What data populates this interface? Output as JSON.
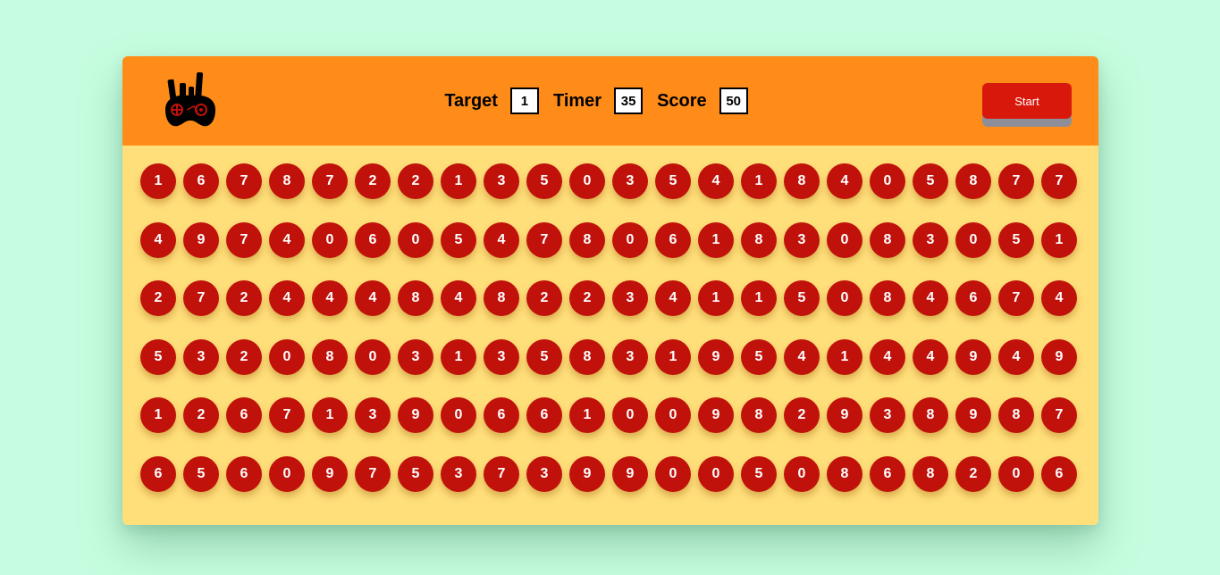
{
  "header": {
    "logo": "game-controller-hand-logo",
    "target_label": "Target",
    "target_value": "1",
    "timer_label": "Timer",
    "timer_value": "35",
    "score_label": "Score",
    "score_value": "50",
    "start_label": "Start"
  },
  "colors": {
    "background": "#c6fde0",
    "header": "#ff8c19",
    "board": "#ffdf7a",
    "ball": "#c0120b",
    "start_button": "#d9180c"
  },
  "board": {
    "rows": [
      [
        "1",
        "6",
        "7",
        "8",
        "7",
        "2",
        "2",
        "1",
        "3",
        "5",
        "0",
        "3",
        "5",
        "4",
        "1",
        "8",
        "4",
        "0",
        "5",
        "8",
        "7",
        "7"
      ],
      [
        "4",
        "9",
        "7",
        "4",
        "0",
        "6",
        "0",
        "5",
        "4",
        "7",
        "8",
        "0",
        "6",
        "1",
        "8",
        "3",
        "0",
        "8",
        "3",
        "0",
        "5",
        "1"
      ],
      [
        "2",
        "7",
        "2",
        "4",
        "4",
        "4",
        "8",
        "4",
        "8",
        "2",
        "2",
        "3",
        "4",
        "1",
        "1",
        "5",
        "0",
        "8",
        "4",
        "6",
        "7",
        "4"
      ],
      [
        "5",
        "3",
        "2",
        "0",
        "8",
        "0",
        "3",
        "1",
        "3",
        "5",
        "8",
        "3",
        "1",
        "9",
        "5",
        "4",
        "1",
        "4",
        "4",
        "9",
        "4",
        "9"
      ],
      [
        "1",
        "2",
        "6",
        "7",
        "1",
        "3",
        "9",
        "0",
        "6",
        "6",
        "1",
        "0",
        "0",
        "9",
        "8",
        "2",
        "9",
        "3",
        "8",
        "9",
        "8",
        "7"
      ],
      [
        "6",
        "5",
        "6",
        "0",
        "9",
        "7",
        "5",
        "3",
        "7",
        "3",
        "9",
        "9",
        "0",
        "0",
        "5",
        "0",
        "8",
        "6",
        "8",
        "2",
        "0",
        "6"
      ]
    ]
  }
}
